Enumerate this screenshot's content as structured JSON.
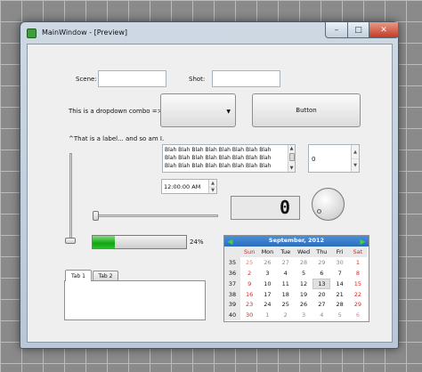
{
  "window": {
    "title": "MainWindow - [Preview]"
  },
  "form": {
    "scene_label": "Scene:",
    "scene_value": "",
    "shot_label": "Shot:",
    "shot_value": "",
    "combo_label": "This is a dropdown combo =>",
    "combo_value": "",
    "button_label": "Button",
    "label_text": "^That is a label... and so am I.",
    "text_lines": [
      "Blah Blah Blah Blah Blah Blah Blah Blah",
      "Blah Blah Blah Blah Blah Blah Blah Blah",
      "Blah Blah Blah Blah Blah Blah Blah Blah"
    ],
    "spinbox_value": "0",
    "time_value": "12:00:00 AM",
    "lcd_value": "0",
    "progress_percent": 24,
    "progress_text": "24%",
    "tabs": [
      "Tab 1",
      "Tab 2"
    ],
    "active_tab": 0
  },
  "calendar": {
    "title": "September,  2012",
    "prev_icon": "arrow-left-icon",
    "next_icon": "arrow-right-icon",
    "weekdays": [
      "Sun",
      "Mon",
      "Tue",
      "Wed",
      "Thu",
      "Fri",
      "Sat"
    ],
    "weeks": [
      {
        "week": "35",
        "days": [
          25,
          26,
          27,
          28,
          29,
          30,
          1
        ]
      },
      {
        "week": "36",
        "days": [
          2,
          3,
          4,
          5,
          6,
          7,
          8
        ]
      },
      {
        "week": "37",
        "days": [
          9,
          10,
          11,
          12,
          13,
          14,
          15
        ]
      },
      {
        "week": "38",
        "days": [
          16,
          17,
          18,
          19,
          20,
          21,
          22
        ]
      },
      {
        "week": "39",
        "days": [
          23,
          24,
          25,
          26,
          27,
          28,
          29
        ]
      },
      {
        "week": "40",
        "days": [
          30,
          1,
          2,
          3,
          4,
          5,
          6
        ]
      }
    ],
    "today": 13,
    "colors": {
      "header": "#2c6cbf",
      "weekend": "#d02a2a",
      "nav_arrow": "#3fd43f"
    }
  },
  "colors": {
    "progress_fill": "#13a313",
    "close_button": "#c43b25"
  }
}
